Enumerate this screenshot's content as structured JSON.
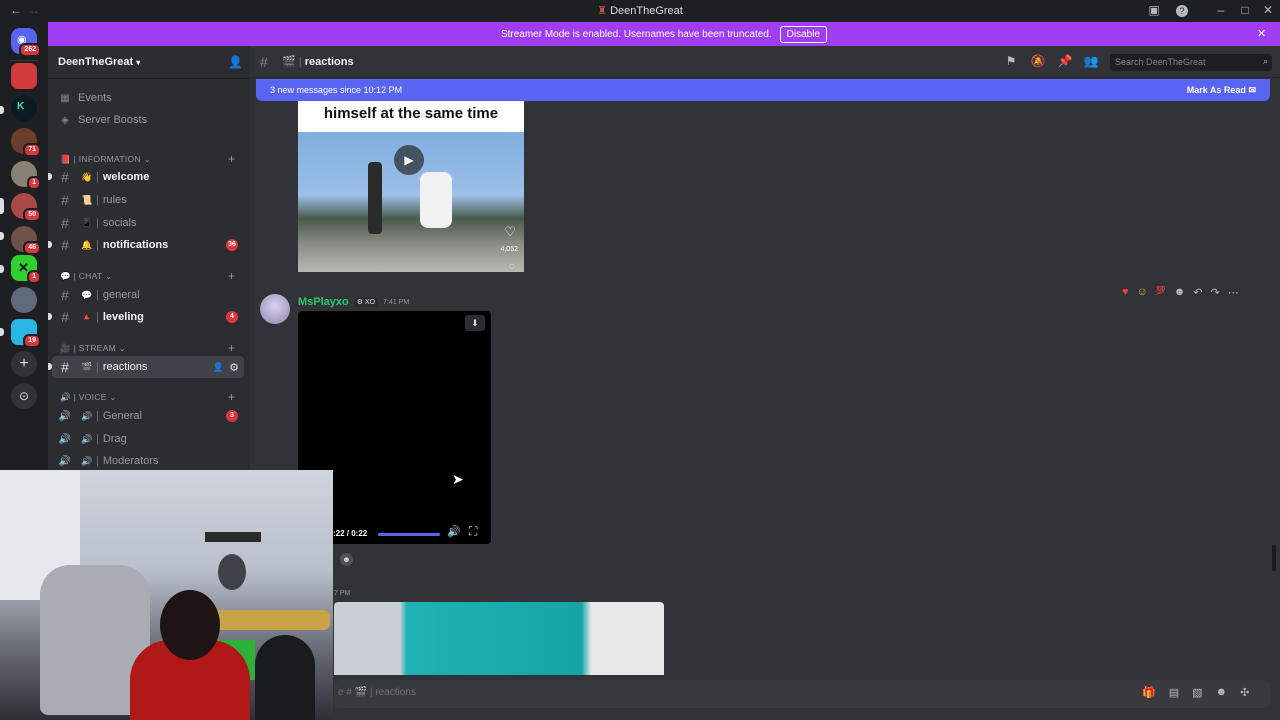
{
  "window": {
    "title": "DeenTheGreat"
  },
  "banner": {
    "text": "Streamer Mode is enabled. Usernames have been truncated.",
    "button": "Disable"
  },
  "rail": {
    "badges": [
      "262",
      "71",
      "1",
      "50",
      "46",
      "1",
      "19"
    ]
  },
  "guild": {
    "name": "DeenTheGreat"
  },
  "sidebar": {
    "top_items": [
      "Events",
      "Server Boosts"
    ],
    "categories": [
      "| INFORMATION",
      "| CHAT",
      "| STREAM",
      "| VOICE"
    ],
    "channels": [
      {
        "emoji": "👋",
        "name": "welcome",
        "unread": true,
        "count": ""
      },
      {
        "emoji": "📜",
        "name": "rules",
        "unread": false,
        "count": ""
      },
      {
        "emoji": "📱",
        "name": "socials",
        "unread": false,
        "count": ""
      },
      {
        "emoji": "🔔",
        "name": "notifications",
        "unread": true,
        "count": "36"
      },
      {
        "emoji": "💬",
        "name": "general",
        "unread": false,
        "count": ""
      },
      {
        "emoji": "🔺",
        "name": "leveling",
        "unread": true,
        "count": "4"
      },
      {
        "emoji": "🎬",
        "name": "reactions",
        "unread": true,
        "count": ""
      }
    ],
    "voice": [
      {
        "name": "General",
        "count": "3"
      },
      {
        "name": "Drag",
        "count": ""
      },
      {
        "name": "Moderators",
        "count": ""
      }
    ]
  },
  "header": {
    "channel": "reactions",
    "search_placeholder": "Search DeenTheGreat"
  },
  "newmsg": {
    "text": "3 new messages since 10:12 PM",
    "action": "Mark As Read"
  },
  "embed": {
    "caption": "himself at the same time",
    "likes": "4,052"
  },
  "message": {
    "author": "MsPlayxo",
    "tag": "XO",
    "time": "7:41 PM",
    "video_time": ":22 / 0:22",
    "video_progress": 1.0
  },
  "message2": {
    "time": "7 PM"
  },
  "composer": {
    "placeholder": "e # 🎬 | reactions"
  },
  "colors": {
    "accent": "#5865f2",
    "banner": "#a03df0",
    "badge": "#da373c",
    "author": "#2dc770"
  }
}
